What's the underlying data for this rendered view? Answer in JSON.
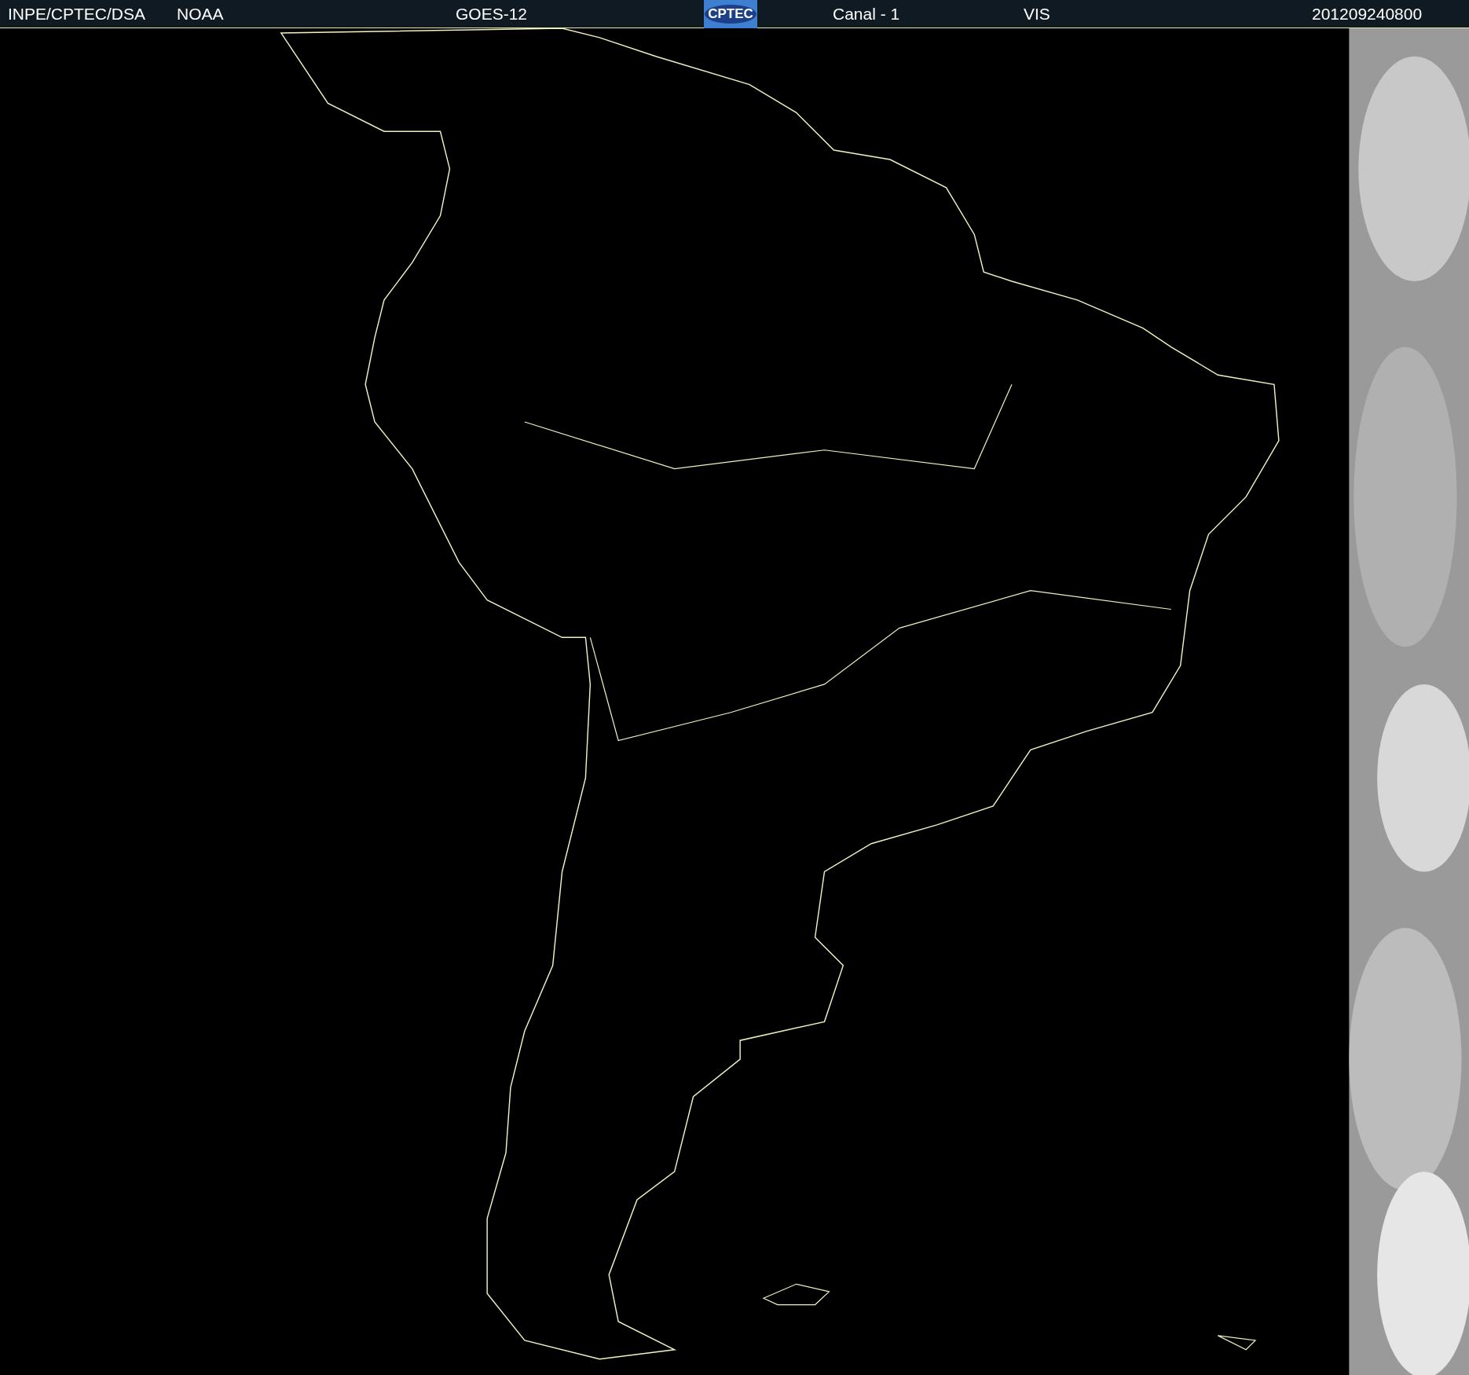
{
  "header": {
    "items": [
      {
        "kind": "text",
        "text": "INPE/CPTEC/DSA"
      },
      {
        "kind": "text",
        "text": "NOAA"
      },
      {
        "kind": "text",
        "text": "GOES-12"
      },
      {
        "kind": "logo",
        "text": "CPTEC"
      },
      {
        "kind": "text",
        "text": "Canal - 1"
      },
      {
        "kind": "text",
        "text": "VIS"
      },
      {
        "kind": "text",
        "text": "201209240800"
      }
    ]
  }
}
